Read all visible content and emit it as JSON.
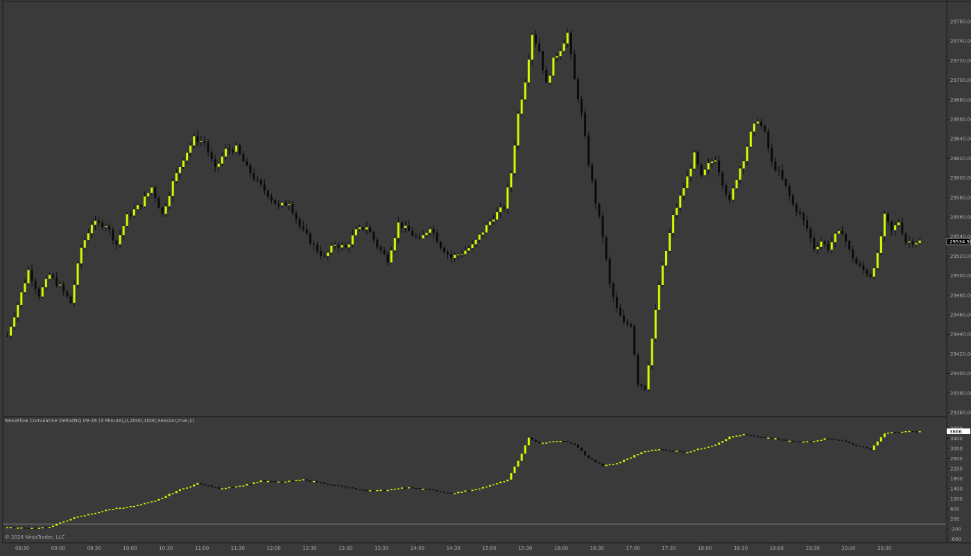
{
  "theme": {
    "background": "#3a3a3a",
    "bull_color": "#ccff00",
    "bear_color": "#0a0a0a",
    "wick_color": "#0a0a0a",
    "axis_text_color": "#a9a9a9"
  },
  "indicator": {
    "label": "NexxFlow Cumulative Delta(NQ 09-26 (3 Minute),0,2000,1000,Session,true,1)"
  },
  "copyright": "© 2026 NinjaTrader, LLC",
  "price_axis": {
    "ticks": [
      "29760.00",
      "29740.00",
      "29720.00",
      "29700.00",
      "29680.00",
      "29660.00",
      "29640.00",
      "29620.00",
      "29600.00",
      "29580.00",
      "29560.00",
      "29540.00",
      "29520.00",
      "29500.00",
      "29480.00",
      "29460.00",
      "29440.00",
      "29420.00",
      "29400.00",
      "29380.00",
      "29360.00"
    ],
    "current_label": "29534.50"
  },
  "delta_axis": {
    "ticks": [
      "3800",
      "3400",
      "3000",
      "2600",
      "2200",
      "1800",
      "1400",
      "1000",
      "600",
      "200",
      "-200",
      "-600"
    ],
    "current_label": "3666"
  },
  "time_axis": {
    "ticks": [
      "08:30",
      "09:00",
      "09:30",
      "10:00",
      "10:30",
      "11:00",
      "11:30",
      "12:00",
      "12:30",
      "13:00",
      "13:30",
      "14:00",
      "14:30",
      "15:00",
      "15:30",
      "16:00",
      "16:30",
      "17:00",
      "17:30",
      "18:00",
      "18:30",
      "19:00",
      "19:30",
      "20:00",
      "20:30"
    ]
  },
  "chart_data": [
    {
      "type": "candlestick",
      "title": "",
      "ylim": [
        29355,
        29770
      ],
      "current_price": 29534.5,
      "path": [
        [
          0,
          29438
        ],
        [
          3,
          29470
        ],
        [
          6,
          29505
        ],
        [
          9,
          29480
        ],
        [
          12,
          29500
        ],
        [
          15,
          29488
        ],
        [
          18,
          29472
        ],
        [
          21,
          29528
        ],
        [
          24,
          29553
        ],
        [
          28,
          29552
        ],
        [
          31,
          29532
        ],
        [
          34,
          29560
        ],
        [
          38,
          29573
        ],
        [
          41,
          29590
        ],
        [
          44,
          29562
        ],
        [
          47,
          29595
        ],
        [
          50,
          29620
        ],
        [
          53,
          29640
        ],
        [
          56,
          29636
        ],
        [
          59,
          29608
        ],
        [
          62,
          29628
        ],
        [
          65,
          29630
        ],
        [
          68,
          29610
        ],
        [
          71,
          29595
        ],
        [
          74,
          29583
        ],
        [
          77,
          29570
        ],
        [
          80,
          29575
        ],
        [
          83,
          29550
        ],
        [
          87,
          29530
        ],
        [
          90,
          29518
        ],
        [
          93,
          29532
        ],
        [
          96,
          29528
        ],
        [
          99,
          29545
        ],
        [
          102,
          29550
        ],
        [
          105,
          29530
        ],
        [
          108,
          29516
        ],
        [
          111,
          29553
        ],
        [
          114,
          29545
        ],
        [
          117,
          29535
        ],
        [
          120,
          29550
        ],
        [
          123,
          29530
        ],
        [
          126,
          29518
        ],
        [
          129,
          29523
        ],
        [
          132,
          29530
        ],
        [
          135,
          29545
        ],
        [
          138,
          29560
        ],
        [
          141,
          29570
        ],
        [
          143,
          29605
        ],
        [
          145,
          29665
        ],
        [
          147,
          29700
        ],
        [
          149,
          29748
        ],
        [
          151,
          29730
        ],
        [
          153,
          29695
        ],
        [
          155,
          29720
        ],
        [
          157,
          29732
        ],
        [
          159,
          29748
        ],
        [
          161,
          29700
        ],
        [
          163,
          29665
        ],
        [
          165,
          29615
        ],
        [
          167,
          29575
        ],
        [
          169,
          29540
        ],
        [
          171,
          29490
        ],
        [
          173,
          29465
        ],
        [
          175,
          29450
        ],
        [
          177,
          29450
        ],
        [
          179,
          29390
        ],
        [
          181,
          29385
        ],
        [
          183,
          29435
        ],
        [
          185,
          29490
        ],
        [
          187,
          29525
        ],
        [
          189,
          29560
        ],
        [
          191,
          29580
        ],
        [
          193,
          29600
        ],
        [
          195,
          29623
        ],
        [
          197,
          29600
        ],
        [
          199,
          29613
        ],
        [
          201,
          29620
        ],
        [
          203,
          29595
        ],
        [
          205,
          29575
        ],
        [
          207,
          29600
        ],
        [
          209,
          29620
        ],
        [
          211,
          29645
        ],
        [
          213,
          29660
        ],
        [
          215,
          29645
        ],
        [
          217,
          29615
        ],
        [
          219,
          29605
        ],
        [
          221,
          29590
        ],
        [
          223,
          29572
        ],
        [
          225,
          29562
        ],
        [
          227,
          29548
        ],
        [
          229,
          29528
        ],
        [
          231,
          29535
        ],
        [
          233,
          29528
        ],
        [
          235,
          29540
        ],
        [
          237,
          29545
        ],
        [
          239,
          29525
        ],
        [
          241,
          29512
        ],
        [
          243,
          29505
        ],
        [
          245,
          29500
        ],
        [
          247,
          29520
        ],
        [
          249,
          29560
        ],
        [
          251,
          29545
        ],
        [
          253,
          29555
        ],
        [
          255,
          29534.5
        ]
      ]
    },
    {
      "type": "bar",
      "title": "",
      "ylim": [
        -800,
        3900
      ],
      "zero_line": 0,
      "current_value": 3666,
      "path": [
        [
          0,
          -150
        ],
        [
          6,
          -180
        ],
        [
          12,
          -140
        ],
        [
          18,
          200
        ],
        [
          24,
          400
        ],
        [
          30,
          600
        ],
        [
          36,
          700
        ],
        [
          42,
          900
        ],
        [
          48,
          1300
        ],
        [
          54,
          1600
        ],
        [
          60,
          1400
        ],
        [
          66,
          1500
        ],
        [
          72,
          1700
        ],
        [
          78,
          1650
        ],
        [
          84,
          1750
        ],
        [
          90,
          1600
        ],
        [
          96,
          1450
        ],
        [
          102,
          1300
        ],
        [
          108,
          1350
        ],
        [
          114,
          1450
        ],
        [
          120,
          1350
        ],
        [
          126,
          1200
        ],
        [
          132,
          1350
        ],
        [
          138,
          1550
        ],
        [
          142,
          1750
        ],
        [
          145,
          2500
        ],
        [
          148,
          3400
        ],
        [
          151,
          3200
        ],
        [
          157,
          3300
        ],
        [
          161,
          3150
        ],
        [
          165,
          2600
        ],
        [
          169,
          2300
        ],
        [
          173,
          2400
        ],
        [
          177,
          2650
        ],
        [
          181,
          2900
        ],
        [
          185,
          2950
        ],
        [
          189,
          2900
        ],
        [
          193,
          2850
        ],
        [
          197,
          3000
        ],
        [
          201,
          3150
        ],
        [
          205,
          3450
        ],
        [
          209,
          3550
        ],
        [
          213,
          3450
        ],
        [
          217,
          3400
        ],
        [
          221,
          3300
        ],
        [
          225,
          3250
        ],
        [
          229,
          3300
        ],
        [
          233,
          3400
        ],
        [
          237,
          3300
        ],
        [
          241,
          3100
        ],
        [
          245,
          2950
        ],
        [
          249,
          3600
        ],
        [
          255,
          3666
        ]
      ]
    }
  ]
}
